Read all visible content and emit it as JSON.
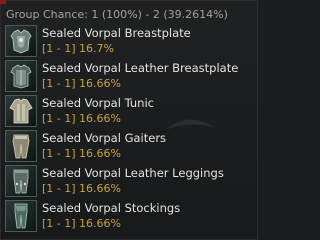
{
  "tooltip": {
    "header": "Group Chance: 1 (100%) - 2 (39.2614%)",
    "items": [
      {
        "name": "Sealed Vorpal Breastplate",
        "chance": "[1 - 1] 16.7%",
        "icon": "breastplate-icon"
      },
      {
        "name": "Sealed Vorpal Leather Breastplate",
        "chance": "[1 - 1] 16.66%",
        "icon": "leather-breastplate-icon"
      },
      {
        "name": "Sealed Vorpal Tunic",
        "chance": "[1 - 1] 16.66%",
        "icon": "tunic-icon"
      },
      {
        "name": "Sealed Vorpal Gaiters",
        "chance": "[1 - 1] 16.66%",
        "icon": "gaiters-icon"
      },
      {
        "name": "Sealed Vorpal Leather Leggings",
        "chance": "[1 - 1] 16.66%",
        "icon": "leather-leggings-icon"
      },
      {
        "name": "Sealed Vorpal Stockings",
        "chance": "[1 - 1] 16.66%",
        "icon": "stockings-icon"
      }
    ]
  },
  "colors": {
    "background": "#1b1d1f",
    "header_text": "#a6a29a",
    "item_name": "#e6e4df",
    "chance_text": "#c9a23a",
    "accent_corner": "#8a1a14"
  }
}
